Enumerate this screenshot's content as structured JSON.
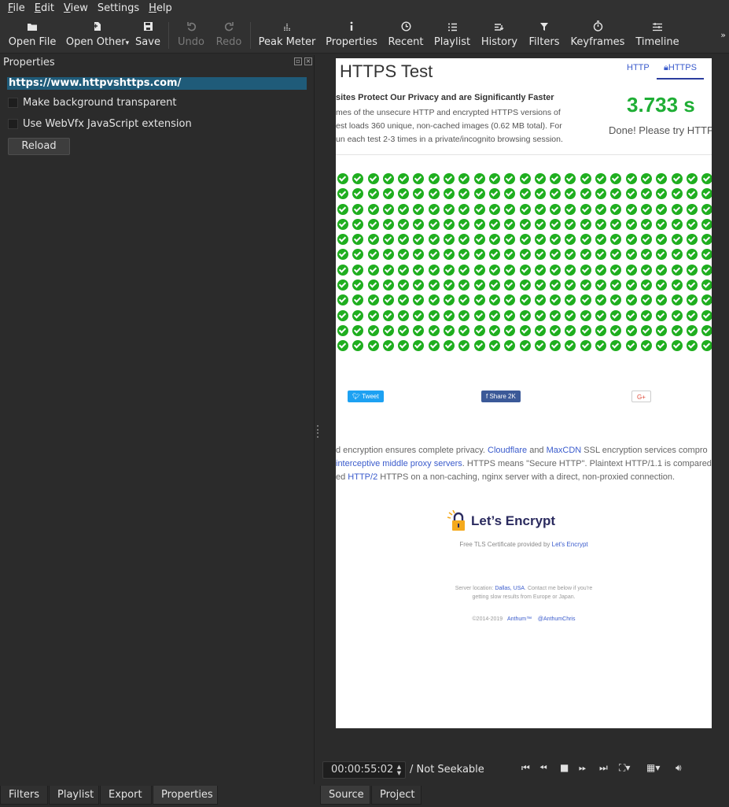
{
  "menubar": [
    {
      "first": "F",
      "rest": "ile"
    },
    {
      "first": "E",
      "rest": "dit"
    },
    {
      "first": "V",
      "rest": "iew"
    },
    {
      "first": "",
      "rest": "Settings"
    },
    {
      "first": "H",
      "rest": "elp"
    }
  ],
  "toolbar": {
    "open_file": "Open File",
    "open_other": "Open Other",
    "save": "Save",
    "undo": "Undo",
    "redo": "Redo",
    "peak_meter": "Peak Meter",
    "properties": "Properties",
    "recent": "Recent",
    "playlist": "Playlist",
    "history": "History",
    "filters": "Filters",
    "keyframes": "Keyframes",
    "timeline": "Timeline",
    "more": "»"
  },
  "properties_panel": {
    "title": "Properties",
    "url": "https://www.httpvshttps.com/",
    "checkbox_transparent": "Make background transparent",
    "checkbox_webvfx": "Use WebVfx JavaScript extension",
    "reload": "Reload"
  },
  "left_tabs": [
    "Filters",
    "Playlist",
    "Export",
    "Properties"
  ],
  "right_tabs": [
    "Source",
    "Project"
  ],
  "viewer": {
    "title": "HTTPS Test",
    "nav_http": "HTTP",
    "nav_https": "HTTPS",
    "subtitle": "sites Protect Our Privacy and are Significantly Faster",
    "desc_lines": [
      "mes of the unsecure HTTP and encrypted HTTPS versions of",
      "est loads 360 unique, non-cached images (0.62 MB total). For",
      "un each test 2-3 times in a private/incognito browsing session."
    ],
    "time": "3.733 s",
    "done": "Done! Please try HTTP",
    "tweet": "Tweet",
    "share": "Share",
    "share_count": "2K",
    "gplus": "G+",
    "para1_a": "d encryption ensures complete privacy. ",
    "para1_link1": "Cloudflare",
    "para1_b": " and ",
    "para1_link2": "MaxCDN",
    "para1_c": " SSL encryption services compro",
    "para2_link": "interceptive middle proxy servers",
    "para2_b": ". HTTPS means \"Secure HTTP\". Plaintext HTTP/1.1 is compared",
    "para3_a": "ed ",
    "para3_link": "HTTP/2",
    "para3_b": " HTTPS on a non-caching, nginx server with a direct, non-proxied connection.",
    "le_name": "Let’s Encrypt",
    "le_sub_a": "Free TLS Certificate provided by ",
    "le_sub_link": "Let's Encrypt",
    "server_a": "Server location: ",
    "server_link": "Dallas, USA",
    "server_b": ". Contact me below if you're",
    "server_c": "getting slow results from Europe or Japan.",
    "copy": "©2014-2019",
    "anthum": "Anthum™",
    "handle": "@AnthumChris"
  },
  "player": {
    "timecode": "00:00:55:02",
    "seek_label": "/ Not Seekable"
  },
  "colors": {
    "accent_url": "#1f5b79",
    "check_green": "#1fae1f",
    "time_green": "#1fae35"
  }
}
